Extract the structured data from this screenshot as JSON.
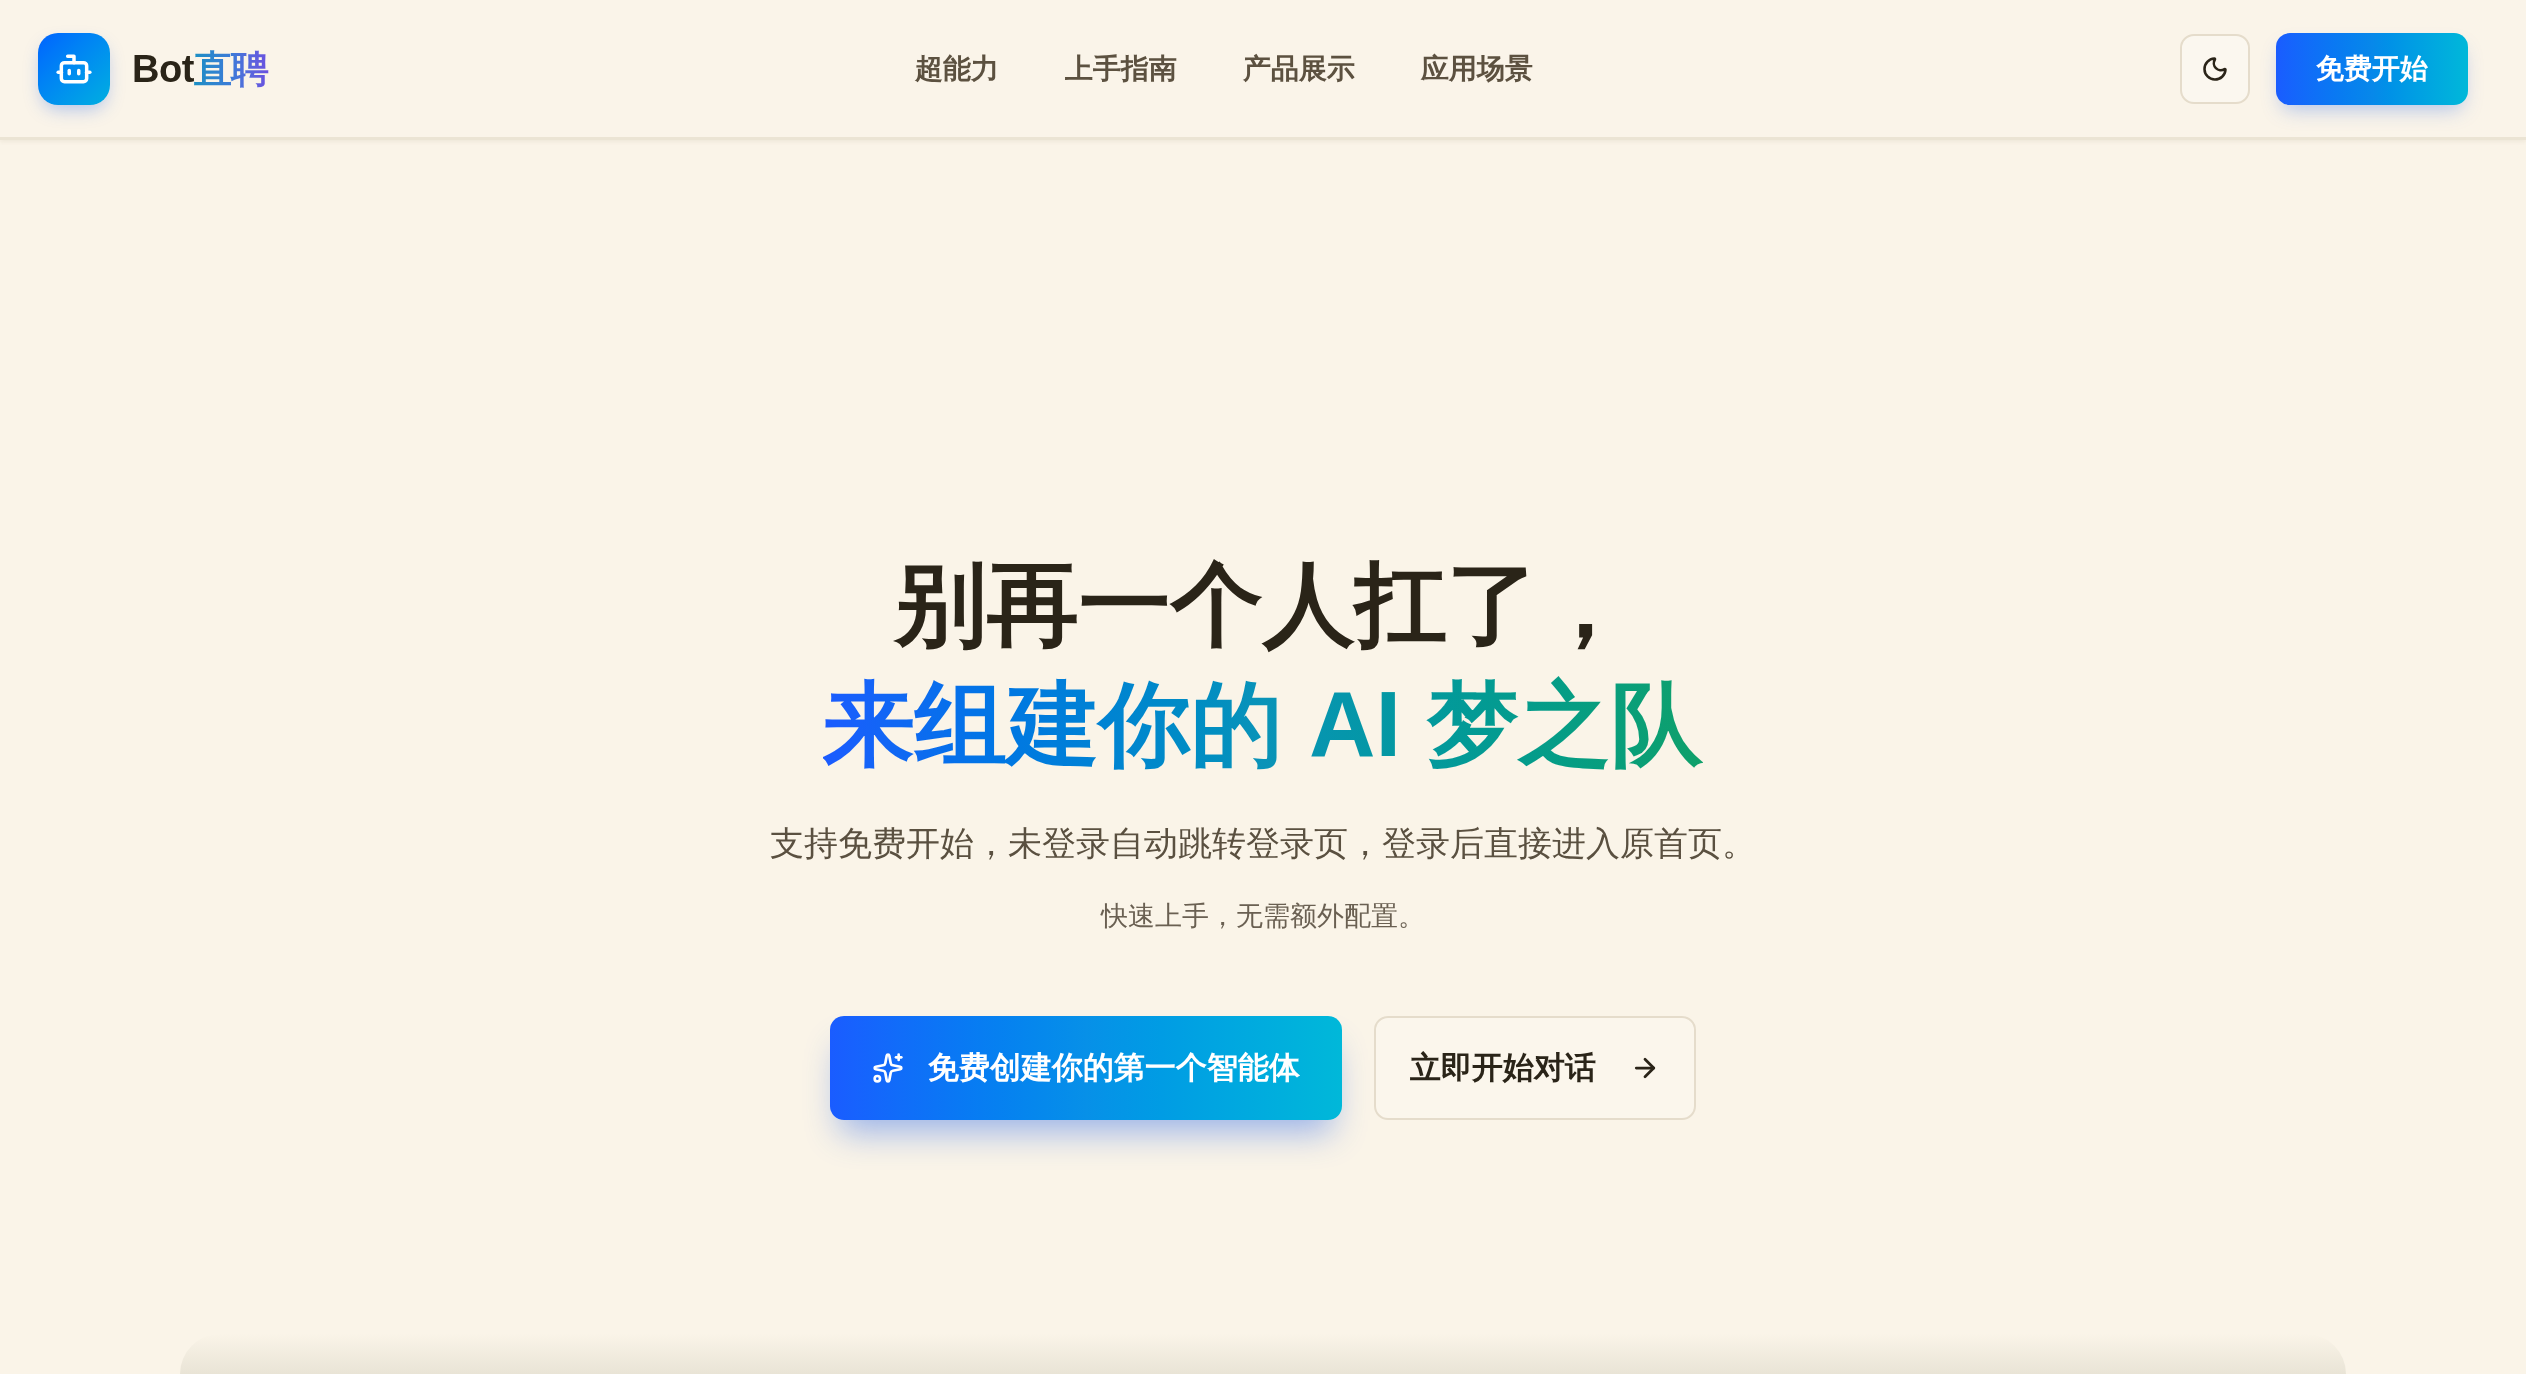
{
  "header": {
    "brand": {
      "name": "Bot",
      "name_accent": "直聘"
    },
    "nav": [
      {
        "label": "超能力"
      },
      {
        "label": "上手指南"
      },
      {
        "label": "产品展示"
      },
      {
        "label": "应用场景"
      }
    ],
    "cta": "免费开始"
  },
  "hero": {
    "title_line_1": "别再一个人扛了，",
    "title_line_2": "来组建你的 AI 梦之队",
    "subtitle": "支持免费开始，未登录自动跳转登录页，登录后直接进入原首页。",
    "note": "快速上手，无需额外配置。",
    "primary_action": "免费创建你的第一个智能体",
    "secondary_action": "立即开始对话"
  }
}
